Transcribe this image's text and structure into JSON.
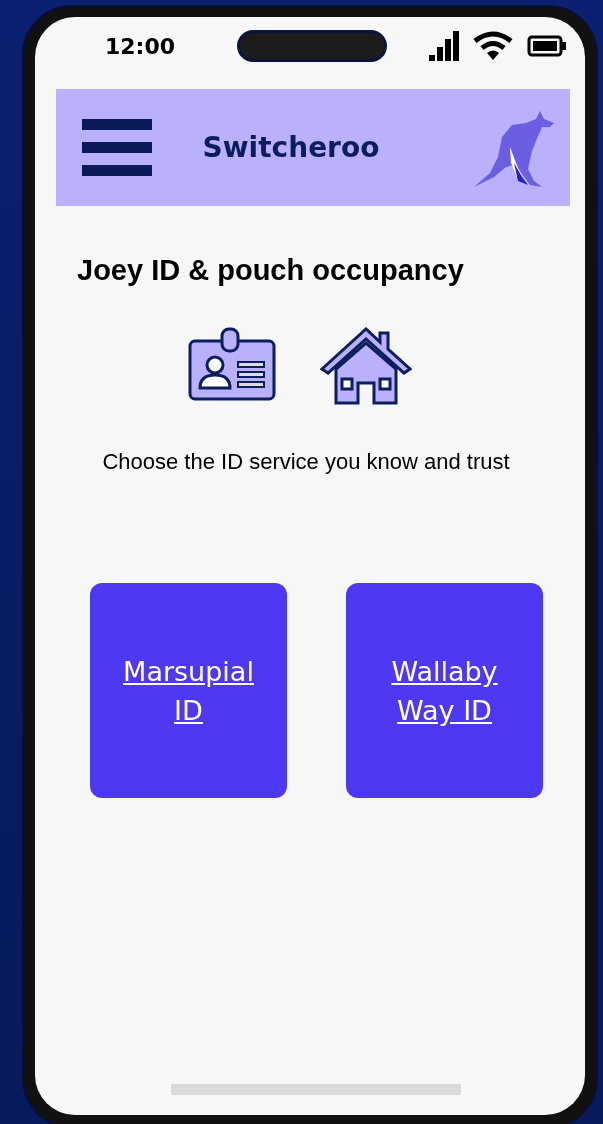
{
  "status_bar": {
    "time": "12:00"
  },
  "header": {
    "title": "Switcheroo"
  },
  "heading": "Joey ID & pouch occupancy",
  "instruction": "Choose the ID service you know and trust",
  "services": [
    {
      "label": "Marsupial ID"
    },
    {
      "label": "Wallaby Way ID"
    }
  ]
}
